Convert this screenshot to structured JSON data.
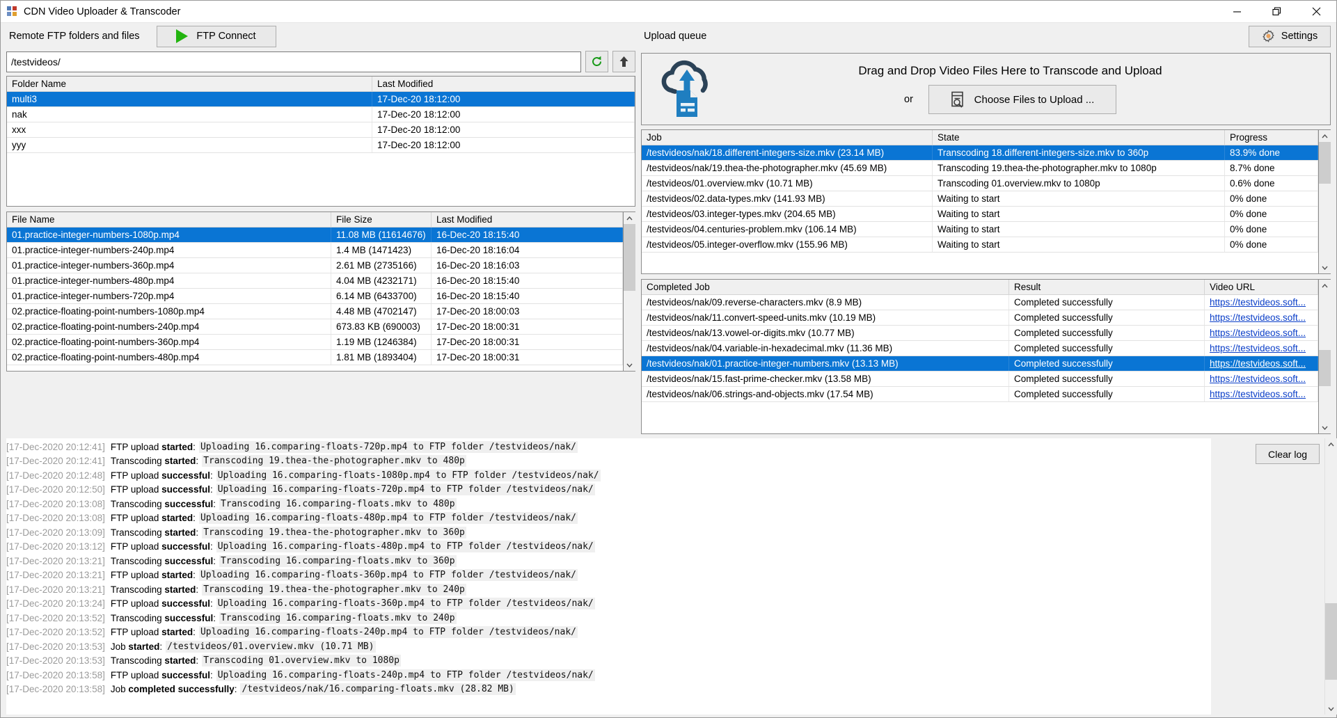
{
  "window": {
    "title": "CDN Video Uploader & Transcoder",
    "minimize": "minimize-icon",
    "maximize": "restore-icon",
    "close": "close-icon"
  },
  "left_panel": {
    "header_label": "Remote FTP folders and files",
    "ftp_connect_label": "FTP Connect",
    "path_value": "/testvideos/",
    "refresh_icon": "refresh-icon",
    "up_icon": "up-arrow-icon",
    "folders": {
      "columns": [
        "Folder Name",
        "Last Modified"
      ],
      "rows": [
        {
          "name": "multi3",
          "modified": "17-Dec-20 18:12:00",
          "selected": true
        },
        {
          "name": "nak",
          "modified": "17-Dec-20 18:12:00",
          "selected": false
        },
        {
          "name": "xxx",
          "modified": "17-Dec-20 18:12:00",
          "selected": false
        },
        {
          "name": "yyy",
          "modified": "17-Dec-20 18:12:00",
          "selected": false
        }
      ]
    },
    "files": {
      "columns": [
        "File Name",
        "File Size",
        "Last Modified"
      ],
      "rows": [
        {
          "name": "01.practice-integer-numbers-1080p.mp4",
          "size": "11.08 MB (11614676)",
          "modified": "16-Dec-20 18:15:40",
          "selected": true
        },
        {
          "name": "01.practice-integer-numbers-240p.mp4",
          "size": "1.4 MB (1471423)",
          "modified": "16-Dec-20 18:16:04",
          "selected": false
        },
        {
          "name": "01.practice-integer-numbers-360p.mp4",
          "size": "2.61 MB (2735166)",
          "modified": "16-Dec-20 18:16:03",
          "selected": false
        },
        {
          "name": "01.practice-integer-numbers-480p.mp4",
          "size": "4.04 MB (4232171)",
          "modified": "16-Dec-20 18:15:40",
          "selected": false
        },
        {
          "name": "01.practice-integer-numbers-720p.mp4",
          "size": "6.14 MB (6433700)",
          "modified": "16-Dec-20 18:15:40",
          "selected": false
        },
        {
          "name": "02.practice-floating-point-numbers-1080p.mp4",
          "size": "4.48 MB (4702147)",
          "modified": "17-Dec-20 18:00:03",
          "selected": false
        },
        {
          "name": "02.practice-floating-point-numbers-240p.mp4",
          "size": "673.83 KB (690003)",
          "modified": "17-Dec-20 18:00:31",
          "selected": false
        },
        {
          "name": "02.practice-floating-point-numbers-360p.mp4",
          "size": "1.19 MB (1246384)",
          "modified": "17-Dec-20 18:00:31",
          "selected": false
        },
        {
          "name": "02.practice-floating-point-numbers-480p.mp4",
          "size": "1.81 MB (1893404)",
          "modified": "17-Dec-20 18:00:31",
          "selected": false
        }
      ]
    }
  },
  "right_panel": {
    "header_label": "Upload queue",
    "settings_label": "Settings",
    "settings_icon": "gear-icon",
    "dropzone": {
      "icon": "cloud-upload-icon",
      "text": "Drag and Drop Video Files Here to Transcode and Upload",
      "or": "or",
      "choose_label": "Choose Files to Upload ...",
      "choose_icon": "browse-file-icon"
    },
    "jobs": {
      "columns": [
        "Job",
        "State",
        "Progress"
      ],
      "rows": [
        {
          "job": "/testvideos/nak/18.different-integers-size.mkv (23.14 MB)",
          "state": "Transcoding 18.different-integers-size.mkv to 360p",
          "progress": "83.9% done",
          "selected": true
        },
        {
          "job": "/testvideos/nak/19.thea-the-photographer.mkv (45.69 MB)",
          "state": "Transcoding 19.thea-the-photographer.mkv to 1080p",
          "progress": "8.7% done",
          "selected": false
        },
        {
          "job": "/testvideos/01.overview.mkv (10.71 MB)",
          "state": "Transcoding 01.overview.mkv to 1080p",
          "progress": "0.6% done",
          "selected": false
        },
        {
          "job": "/testvideos/02.data-types.mkv (141.93 MB)",
          "state": "Waiting to start",
          "progress": "0% done",
          "selected": false
        },
        {
          "job": "/testvideos/03.integer-types.mkv (204.65 MB)",
          "state": "Waiting to start",
          "progress": "0% done",
          "selected": false
        },
        {
          "job": "/testvideos/04.centuries-problem.mkv (106.14 MB)",
          "state": "Waiting to start",
          "progress": "0% done",
          "selected": false
        },
        {
          "job": "/testvideos/05.integer-overflow.mkv (155.96 MB)",
          "state": "Waiting to start",
          "progress": "0% done",
          "selected": false
        }
      ]
    },
    "completed": {
      "columns": [
        "Completed Job",
        "Result",
        "Video URL"
      ],
      "rows": [
        {
          "job": "/testvideos/nak/09.reverse-characters.mkv (8.9 MB)",
          "result": "Completed successfully",
          "url": "https://testvideos.soft...",
          "selected": false
        },
        {
          "job": "/testvideos/nak/11.convert-speed-units.mkv (10.19 MB)",
          "result": "Completed successfully",
          "url": "https://testvideos.soft...",
          "selected": false
        },
        {
          "job": "/testvideos/nak/13.vowel-or-digits.mkv (10.77 MB)",
          "result": "Completed successfully",
          "url": "https://testvideos.soft...",
          "selected": false
        },
        {
          "job": "/testvideos/nak/04.variable-in-hexadecimal.mkv (11.36 MB)",
          "result": "Completed successfully",
          "url": "https://testvideos.soft...",
          "selected": false
        },
        {
          "job": "/testvideos/nak/01.practice-integer-numbers.mkv (13.13 MB)",
          "result": "Completed successfully",
          "url": "https://testvideos.soft...",
          "selected": true
        },
        {
          "job": "/testvideos/nak/15.fast-prime-checker.mkv (13.58 MB)",
          "result": "Completed successfully",
          "url": "https://testvideos.soft...",
          "selected": false
        },
        {
          "job": "/testvideos/nak/06.strings-and-objects.mkv (17.54 MB)",
          "result": "Completed successfully",
          "url": "https://testvideos.soft...",
          "selected": false
        }
      ]
    }
  },
  "log": {
    "clear_label": "Clear log",
    "lines": [
      {
        "ts": "[17-Dec-2020 20:12:41]",
        "kind_plain": "FTP upload ",
        "kind_bold": "started",
        "kind_tail": ":",
        "msg": "Uploading 16.comparing-floats-720p.mp4 to FTP folder /testvideos/nak/"
      },
      {
        "ts": "[17-Dec-2020 20:12:41]",
        "kind_plain": "Transcoding ",
        "kind_bold": "started",
        "kind_tail": ":",
        "msg": "Transcoding 19.thea-the-photographer.mkv to 480p"
      },
      {
        "ts": "[17-Dec-2020 20:12:48]",
        "kind_plain": "FTP upload ",
        "kind_bold": "successful",
        "kind_tail": ":",
        "msg": "Uploading 16.comparing-floats-1080p.mp4 to FTP folder /testvideos/nak/"
      },
      {
        "ts": "[17-Dec-2020 20:12:50]",
        "kind_plain": "FTP upload ",
        "kind_bold": "successful",
        "kind_tail": ":",
        "msg": "Uploading 16.comparing-floats-720p.mp4 to FTP folder /testvideos/nak/"
      },
      {
        "ts": "[17-Dec-2020 20:13:08]",
        "kind_plain": "Transcoding ",
        "kind_bold": "successful",
        "kind_tail": ":",
        "msg": "Transcoding 16.comparing-floats.mkv to 480p"
      },
      {
        "ts": "[17-Dec-2020 20:13:08]",
        "kind_plain": "FTP upload ",
        "kind_bold": "started",
        "kind_tail": ":",
        "msg": "Uploading 16.comparing-floats-480p.mp4 to FTP folder /testvideos/nak/"
      },
      {
        "ts": "[17-Dec-2020 20:13:09]",
        "kind_plain": "Transcoding ",
        "kind_bold": "started",
        "kind_tail": ":",
        "msg": "Transcoding 19.thea-the-photographer.mkv to 360p"
      },
      {
        "ts": "[17-Dec-2020 20:13:12]",
        "kind_plain": "FTP upload ",
        "kind_bold": "successful",
        "kind_tail": ":",
        "msg": "Uploading 16.comparing-floats-480p.mp4 to FTP folder /testvideos/nak/"
      },
      {
        "ts": "[17-Dec-2020 20:13:21]",
        "kind_plain": "Transcoding ",
        "kind_bold": "successful",
        "kind_tail": ":",
        "msg": "Transcoding 16.comparing-floats.mkv to 360p"
      },
      {
        "ts": "[17-Dec-2020 20:13:21]",
        "kind_plain": "FTP upload ",
        "kind_bold": "started",
        "kind_tail": ":",
        "msg": "Uploading 16.comparing-floats-360p.mp4 to FTP folder /testvideos/nak/"
      },
      {
        "ts": "[17-Dec-2020 20:13:21]",
        "kind_plain": "Transcoding ",
        "kind_bold": "started",
        "kind_tail": ":",
        "msg": "Transcoding 19.thea-the-photographer.mkv to 240p"
      },
      {
        "ts": "[17-Dec-2020 20:13:24]",
        "kind_plain": "FTP upload ",
        "kind_bold": "successful",
        "kind_tail": ":",
        "msg": "Uploading 16.comparing-floats-360p.mp4 to FTP folder /testvideos/nak/"
      },
      {
        "ts": "[17-Dec-2020 20:13:52]",
        "kind_plain": "Transcoding ",
        "kind_bold": "successful",
        "kind_tail": ":",
        "msg": "Transcoding 16.comparing-floats.mkv to 240p"
      },
      {
        "ts": "[17-Dec-2020 20:13:52]",
        "kind_plain": "FTP upload ",
        "kind_bold": "started",
        "kind_tail": ":",
        "msg": "Uploading 16.comparing-floats-240p.mp4 to FTP folder /testvideos/nak/"
      },
      {
        "ts": "[17-Dec-2020 20:13:53]",
        "kind_plain": "Job ",
        "kind_bold": "started",
        "kind_tail": ":",
        "msg": "/testvideos/01.overview.mkv (10.71 MB)"
      },
      {
        "ts": "[17-Dec-2020 20:13:53]",
        "kind_plain": "Transcoding ",
        "kind_bold": "started",
        "kind_tail": ":",
        "msg": "Transcoding 01.overview.mkv to 1080p"
      },
      {
        "ts": "[17-Dec-2020 20:13:58]",
        "kind_plain": "FTP upload ",
        "kind_bold": "successful",
        "kind_tail": ":",
        "msg": "Uploading 16.comparing-floats-240p.mp4 to FTP folder /testvideos/nak/"
      },
      {
        "ts": "[17-Dec-2020 20:13:58]",
        "kind_plain": "Job ",
        "kind_bold": "completed successfully",
        "kind_tail": ":",
        "msg": "/testvideos/nak/16.comparing-floats.mkv (28.82 MB)"
      }
    ]
  },
  "colors": {
    "selection": "#0a75d4",
    "accent_green": "#22b40f",
    "link": "#0a3ec8",
    "gear": "#e8a25f",
    "cloud_dark": "#2b4257",
    "cloud_blue": "#1f7ec0"
  }
}
